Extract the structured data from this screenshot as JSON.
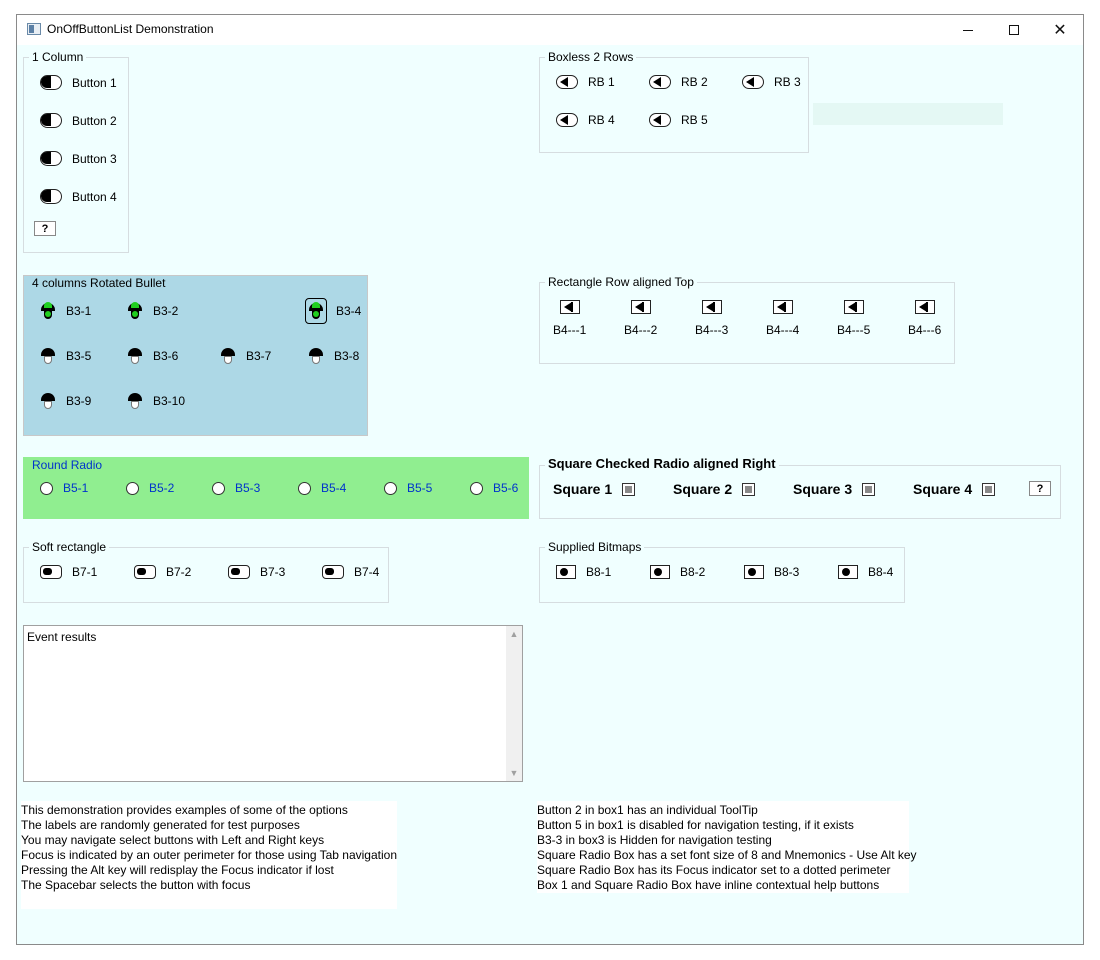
{
  "window": {
    "title": "OnOffButtonList Demonstration"
  },
  "box1": {
    "title": "1 Column",
    "items": [
      "Button 1",
      "Button 2",
      "Button 3",
      "Button 4"
    ],
    "help": "?"
  },
  "boxless": {
    "title": "Boxless 2 Rows",
    "items": [
      "RB 1",
      "RB 2",
      "RB 3",
      "RB 4",
      "RB 5"
    ]
  },
  "box3": {
    "title": "4 columns Rotated Bullet",
    "bg_color": "#add8e6",
    "items": [
      {
        "label": "B3-1",
        "on": true
      },
      {
        "label": "B3-2",
        "on": true
      },
      {
        "label": "B3-4",
        "on": true,
        "focused": true
      },
      {
        "label": "B3-5",
        "on": false
      },
      {
        "label": "B3-6",
        "on": false
      },
      {
        "label": "B3-7",
        "on": false
      },
      {
        "label": "B3-8",
        "on": false
      },
      {
        "label": "B3-9",
        "on": false
      },
      {
        "label": "B3-10",
        "on": false
      }
    ]
  },
  "box4": {
    "title": "Rectangle Row aligned Top",
    "items": [
      "B4---1",
      "B4---2",
      "B4---3",
      "B4---4",
      "B4---5",
      "B4---6"
    ]
  },
  "box5": {
    "title": "Round Radio",
    "bg_color": "#90ee90",
    "text_color": "#0033cc",
    "items": [
      "B5-1",
      "B5-2",
      "B5-3",
      "B5-4",
      "B5-5",
      "B5-6"
    ]
  },
  "square": {
    "title": "Square Checked Radio aligned Right",
    "items": [
      "Square 1",
      "Square 2",
      "Square 3",
      "Square 4"
    ],
    "help": "?"
  },
  "box7": {
    "title": "Soft rectangle",
    "items": [
      "B7-1",
      "B7-2",
      "B7-3",
      "B7-4"
    ]
  },
  "box8": {
    "title": "Supplied Bitmaps",
    "items": [
      "B8-1",
      "B8-2",
      "B8-3",
      "B8-4"
    ]
  },
  "events": {
    "label": "Event results"
  },
  "info_left": [
    "This demonstration provides examples of some of the options",
    "The labels are randomly generated for test purposes",
    "You may navigate select buttons with Left and Right keys",
    "Focus is indicated by an outer perimeter for those using Tab navigation",
    "Pressing the Alt key will redisplay the Focus indicator if lost",
    "The Spacebar selects the button with focus"
  ],
  "info_right": [
    "Button 2 in box1 has an individual ToolTip",
    "Button 5 in box1 is disabled for navigation testing, if it exists",
    "B3-3 in box3 is Hidden for navigation testing",
    "Square Radio Box has a set font size of 8 and Mnemonics - Use Alt key",
    "Square Radio Box has its Focus indicator set to a dotted perimeter",
    "Box 1 and Square Radio Box have inline contextual help buttons"
  ]
}
